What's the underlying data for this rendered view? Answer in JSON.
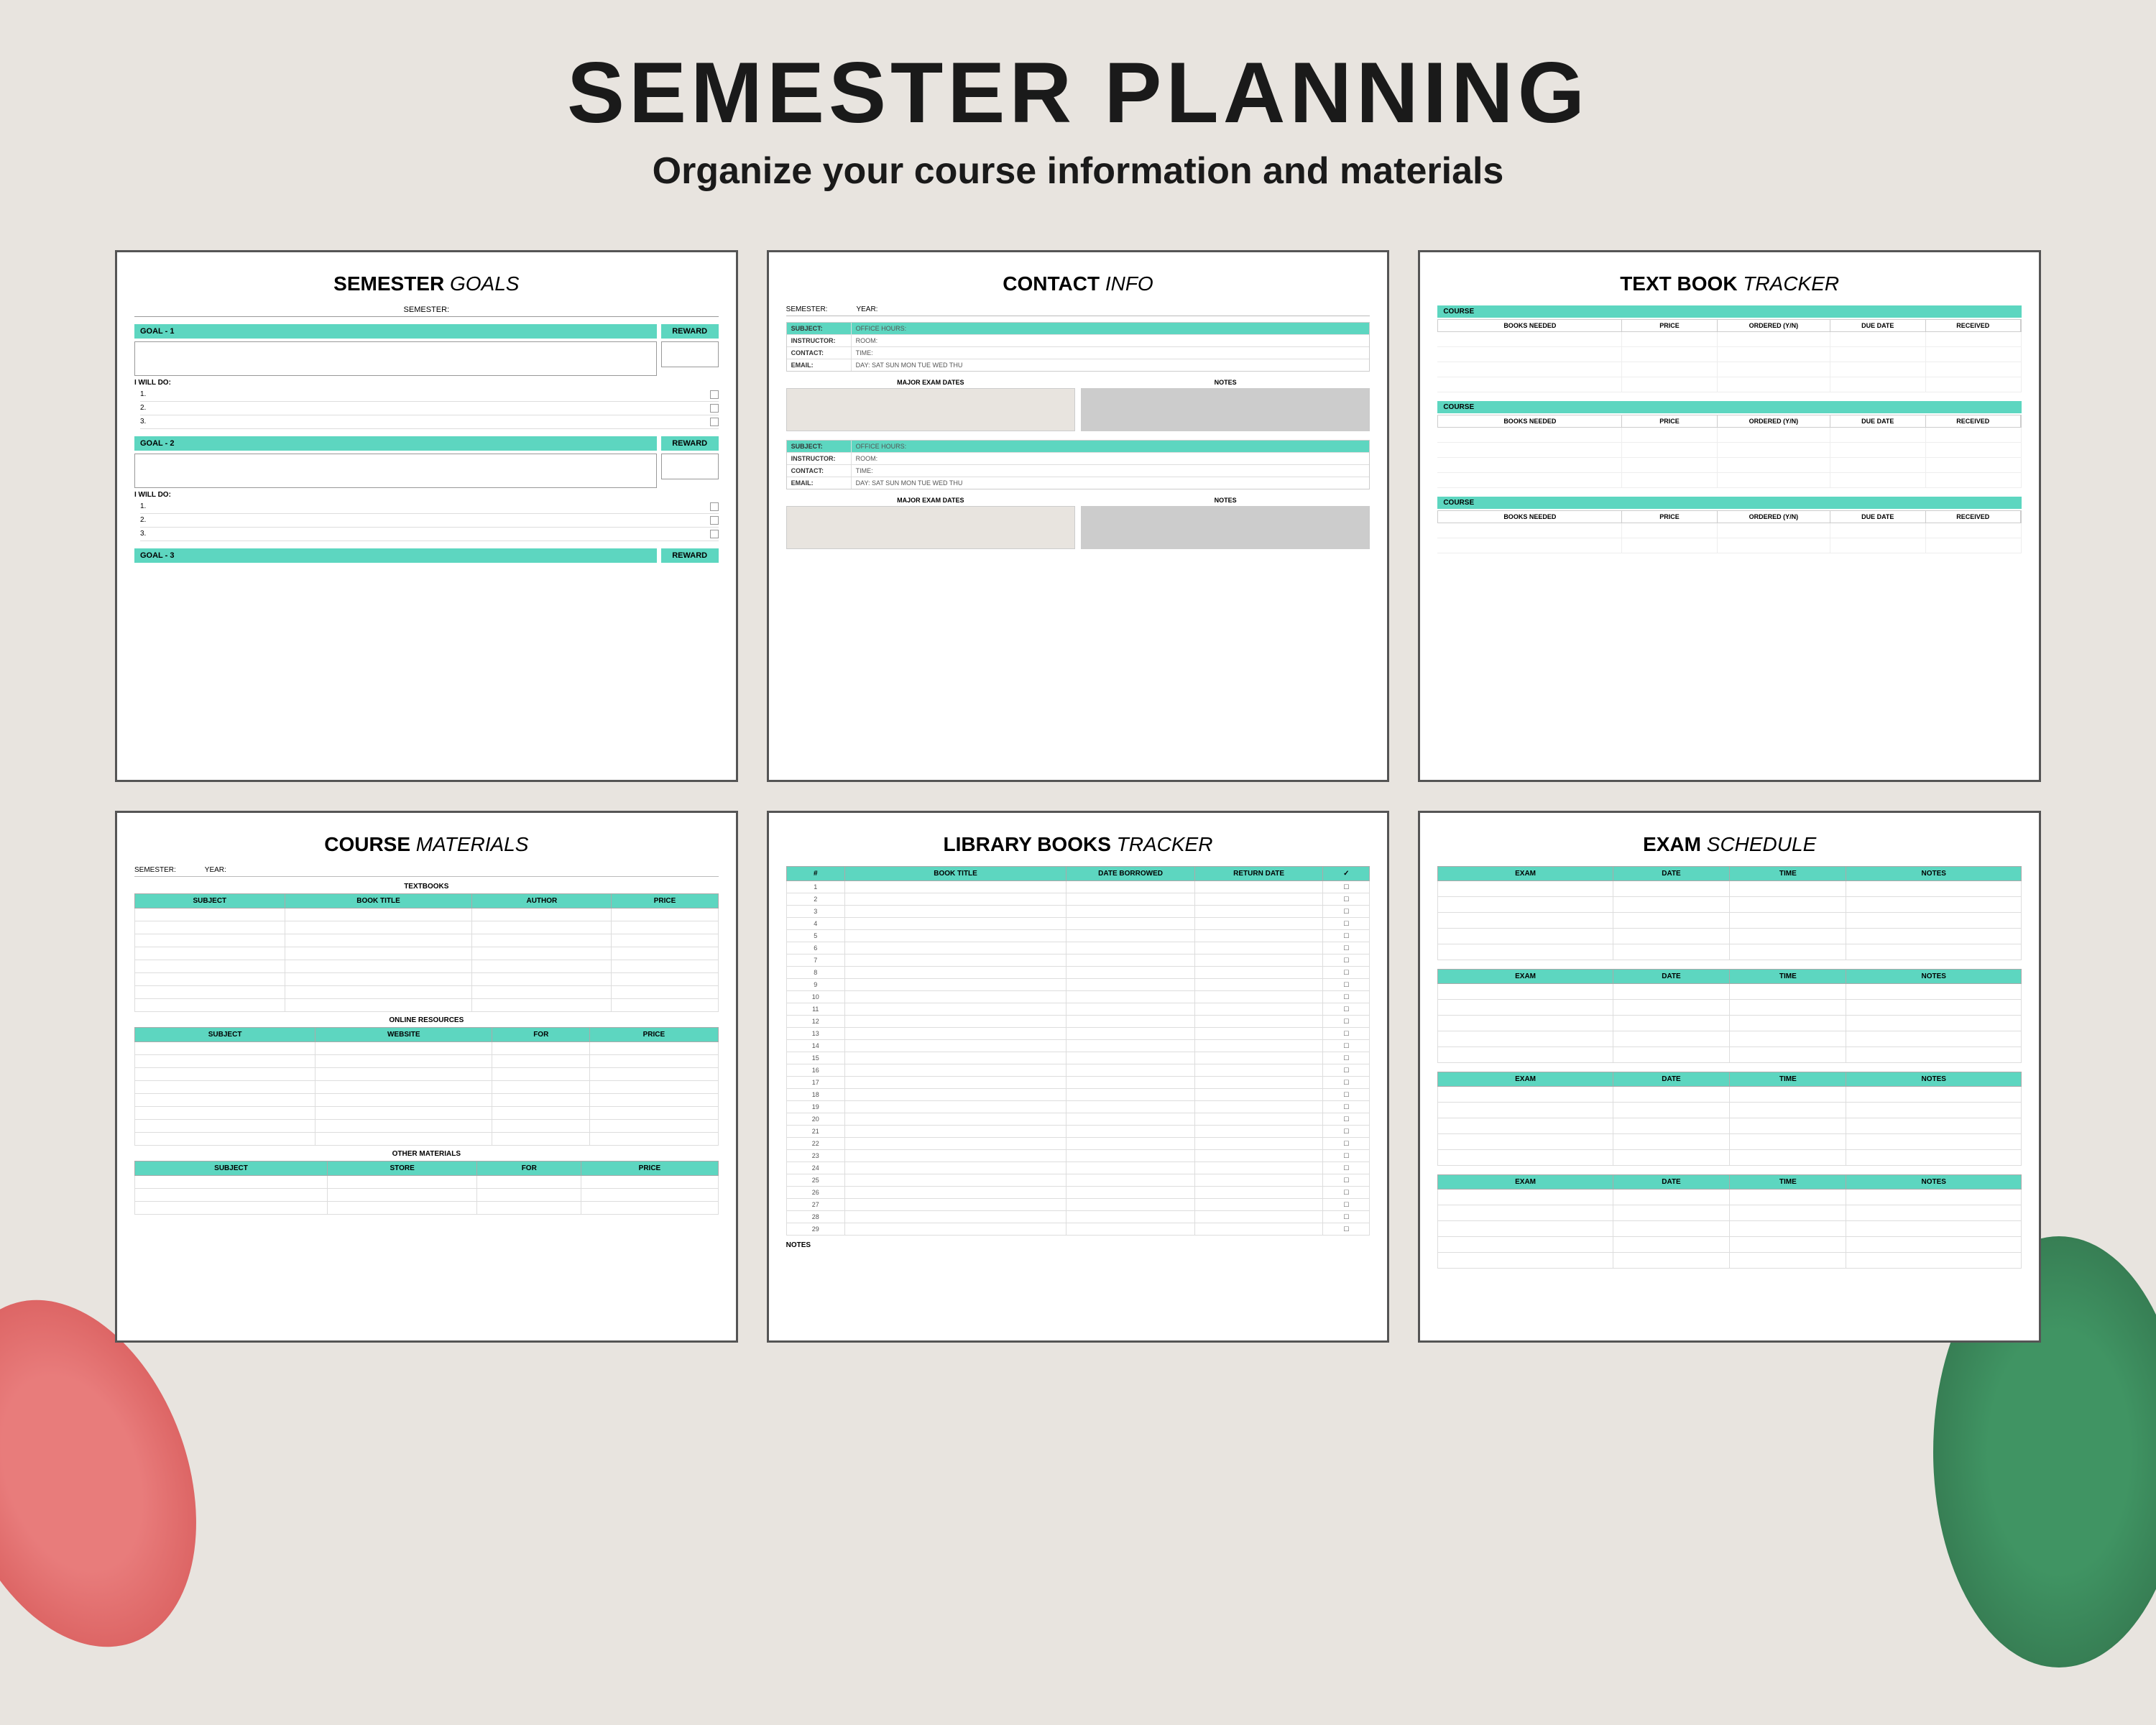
{
  "header": {
    "title": "SEMESTER PLANNING",
    "subtitle": "Organize your course information and materials"
  },
  "pages": {
    "goals": {
      "title": "SEMESTER",
      "title_italic": "GOALS",
      "semester_label": "SEMESTER:",
      "goals": [
        {
          "label": "GOAL - 1",
          "reward": "REWARD"
        },
        {
          "label": "GOAL - 2",
          "reward": "REWARD"
        },
        {
          "label": "GOAL - 3",
          "reward": "REWARD"
        }
      ],
      "will_do_label": "I WILL DO:",
      "items": [
        "1.",
        "2.",
        "3."
      ]
    },
    "contact": {
      "title": "CONTACT",
      "title_italic": "INFO",
      "semester_label": "SEMESTER:",
      "year_label": "YEAR:",
      "fields": [
        "SUBJECT:",
        "INSTRUCTOR:",
        "CONTACT:",
        "EMAIL:"
      ],
      "fields2": [
        "OFFICE HOURS:",
        "ROOM:",
        "TIME:",
        "DAY:"
      ],
      "days": "SAT  SUN  MON  TUE  WED  THU",
      "major_exam_dates": "MAJOR EXAM DATES",
      "notes": "NOTES"
    },
    "textbook": {
      "title": "TEXT BOOK",
      "title_italic": "TRACKER",
      "course_label": "COURSE",
      "columns": [
        "BOOKS NEEDED",
        "PRICE",
        "ORDERED (Y/N)",
        "DUE DATE",
        "RECEIVED"
      ],
      "sections": 3
    },
    "materials": {
      "title": "COURSE",
      "title_italic": "MATERIALS",
      "semester_label": "SEMESTER:",
      "year_label": "YEAR:",
      "textbooks_label": "TEXTBOOKS",
      "textbooks_cols": [
        "SUBJECT",
        "BOOK TITLE",
        "AUTHOR",
        "PRICE"
      ],
      "online_label": "ONLINE RESOURCES",
      "online_cols": [
        "SUBJECT",
        "WEBSITE",
        "FOR",
        "PRICE"
      ],
      "other_label": "OTHER MATERIALS",
      "other_cols": [
        "SUBJECT",
        "STORE",
        "FOR",
        "PRICE"
      ],
      "rows": 8
    },
    "library": {
      "title": "LIBRARY BOOKS",
      "title_italic": "TRACKER",
      "columns": [
        "#",
        "BOOK TITLE",
        "DATE BORROWED",
        "RETURN DATE",
        "✓"
      ],
      "rows": 29,
      "notes_label": "NOTES"
    },
    "exam": {
      "title": "EXAM",
      "title_italic": "SCHEDULE",
      "columns": [
        "EXAM",
        "DATE",
        "TIME",
        "NOTES"
      ],
      "sections": 4,
      "rows_per_section": 5
    }
  }
}
